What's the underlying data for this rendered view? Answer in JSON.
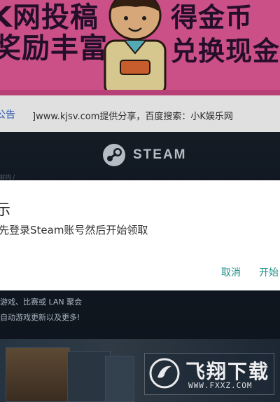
{
  "banner": {
    "left_line_1": "K网投稿",
    "left_line_2": "奖励丰富",
    "right_line_1": "得金币",
    "right_line_2": "兑换现金"
  },
  "ad_notice": {
    "tag": "公告",
    "text": "]www.kjsv.com提供分享，百度搜索：小K娱乐网"
  },
  "steam": {
    "logo_text": "STEAM",
    "breadcrumb": "好内 /",
    "feature_line_1": "游戏、比赛或 LAN 聚会",
    "feature_line_2": "自动游戏更新以及更多!"
  },
  "dialog": {
    "title": "示",
    "message": "先登录Steam账号然后开始领取",
    "cancel_label": "取消",
    "start_label": "开始"
  },
  "watermark": {
    "name": "飞翔下载",
    "url": "WWW.FXXZ.COM"
  },
  "colors": {
    "banner_bg": "#e85c9b",
    "dialog_accent": "#1e8e8a",
    "steam_bg": "#10161f"
  }
}
